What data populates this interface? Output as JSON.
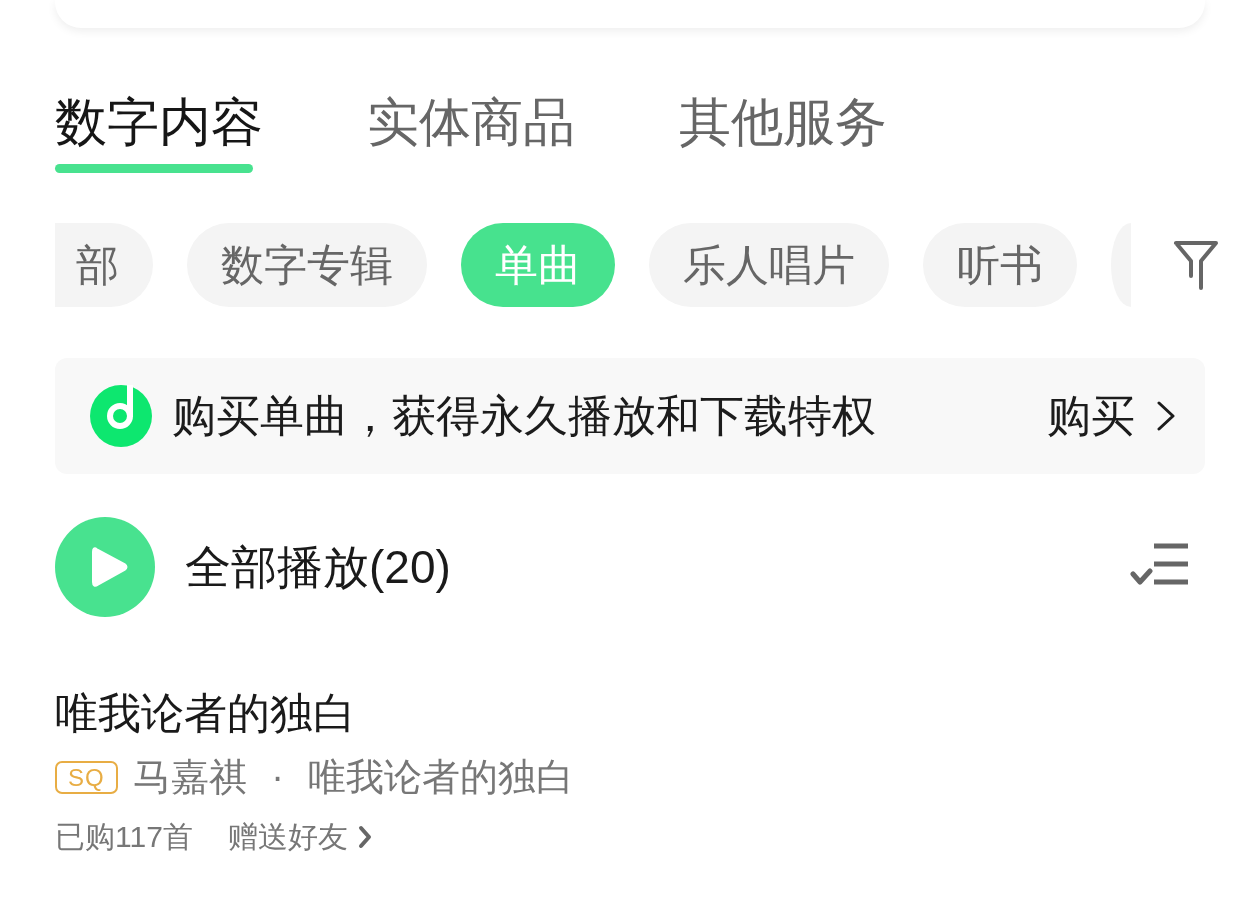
{
  "tabs": [
    {
      "label": "数字内容",
      "selected": true
    },
    {
      "label": "实体商品",
      "selected": false
    },
    {
      "label": "其他服务",
      "selected": false
    }
  ],
  "filter_chips": [
    {
      "kind": "clipped_start",
      "label": "部",
      "selected": false
    },
    {
      "kind": "full",
      "label": "数字专辑",
      "selected": false
    },
    {
      "kind": "full",
      "label": "单曲",
      "selected": true
    },
    {
      "kind": "full",
      "label": "乐人唱片",
      "selected": false
    },
    {
      "kind": "full",
      "label": "听书",
      "selected": false
    },
    {
      "kind": "clipped_end",
      "selected": false
    }
  ],
  "banner": {
    "text": "购买单曲，获得永久播放和下载特权",
    "action": "购买"
  },
  "play_all": {
    "label": "全部播放(20)"
  },
  "songs": [
    {
      "title": "唯我论者的独白",
      "quality": "SQ",
      "subtitle": "马嘉祺 · 唯我论者的独白"
    }
  ],
  "footer": {
    "purchased": "已购117首",
    "gift_link": "赠送好友"
  }
}
